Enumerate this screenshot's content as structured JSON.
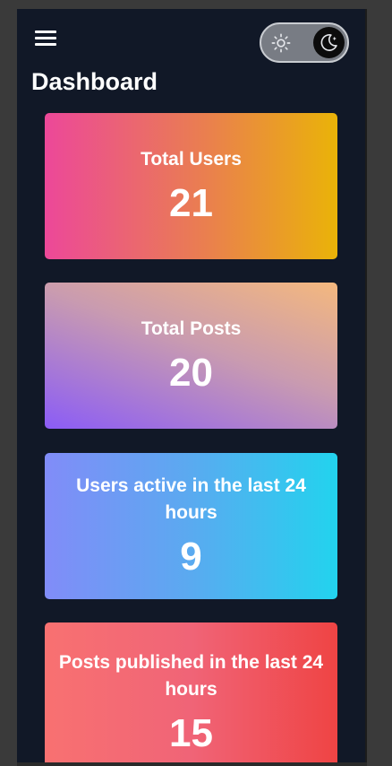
{
  "header": {
    "title": "Dashboard",
    "menu_icon": "hamburger-icon",
    "theme_toggle": {
      "light_icon": "sun-icon",
      "dark_icon": "moon-icon",
      "selected": "dark"
    }
  },
  "stats": [
    {
      "label": "Total Users",
      "value": "21"
    },
    {
      "label": "Total Posts",
      "value": "20"
    },
    {
      "label": "Users active in the last 24 hours",
      "value": "9"
    },
    {
      "label": "Posts published in the last 24 hours",
      "value": "15"
    }
  ],
  "colors": {
    "background": "#111827",
    "text": "#ffffff",
    "card_users": [
      "#ec4899",
      "#eab308"
    ],
    "card_posts": [
      "#8b5cf6",
      "#f4b87e"
    ],
    "card_active": [
      "#818cf8",
      "#22d3ee"
    ],
    "card_published": [
      "#f87171",
      "#ef4444"
    ]
  }
}
